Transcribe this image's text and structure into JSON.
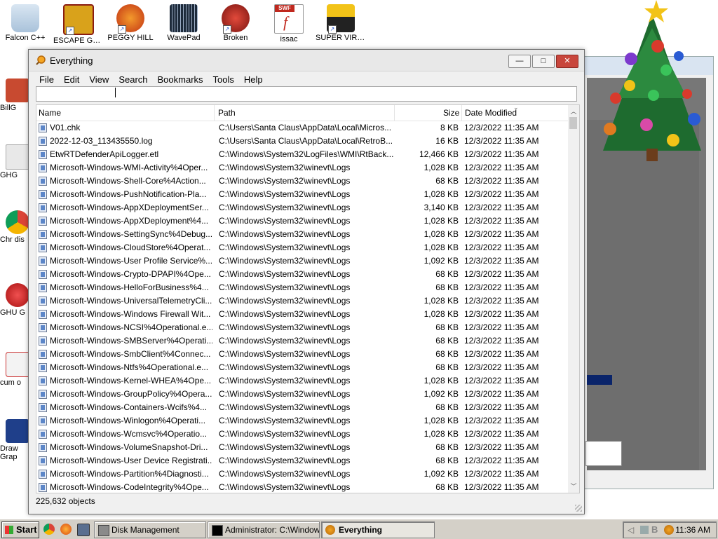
{
  "desktop": {
    "top_icons": [
      {
        "label": "Falcon C++",
        "icon": "recycle-bin-icon"
      },
      {
        "label": "ESCAPE GGP",
        "icon": "game-icon"
      },
      {
        "label": "PEGGY HILL",
        "icon": "game-icon"
      },
      {
        "label": "WavePad",
        "icon": "audio-editor-icon"
      },
      {
        "label": "Broken",
        "icon": "ornament-game-icon"
      },
      {
        "label": "issac",
        "icon": "flash-swf-icon"
      },
      {
        "label": "SUPER VIRUS",
        "icon": "truck-game-icon"
      }
    ],
    "left_icons": [
      "BillG",
      "GHG",
      "Chr dis",
      "GHU G",
      "cum o",
      "Draw Grap"
    ]
  },
  "window": {
    "title": "Everything",
    "buttons": {
      "minimize": "—",
      "maximize": "□",
      "close": "✕"
    },
    "menu": [
      "File",
      "Edit",
      "View",
      "Search",
      "Bookmarks",
      "Tools",
      "Help"
    ],
    "search_value": "",
    "columns": {
      "name": "Name",
      "path": "Path",
      "size": "Size",
      "date": "Date Modified"
    },
    "rows": [
      {
        "name": "V01.chk",
        "path": "C:\\Users\\Santa Claus\\AppData\\Local\\Micros...",
        "size": "8 KB",
        "date": "12/3/2022 11:35 AM",
        "icon": "chk-file-icon"
      },
      {
        "name": "2022-12-03_113435550.log",
        "path": "C:\\Users\\Santa Claus\\AppData\\Local\\RetroB...",
        "size": "16 KB",
        "date": "12/3/2022 11:35 AM",
        "icon": "log-file-icon"
      },
      {
        "name": "EtwRTDefenderApiLogger.etl",
        "path": "C:\\Windows\\System32\\LogFiles\\WMI\\RtBack...",
        "size": "12,466 KB",
        "date": "12/3/2022 11:35 AM",
        "icon": "etl-file-icon"
      },
      {
        "name": "Microsoft-Windows-WMI-Activity%4Oper...",
        "path": "C:\\Windows\\System32\\winevt\\Logs",
        "size": "1,028 KB",
        "date": "12/3/2022 11:35 AM",
        "icon": "evtx-file-icon"
      },
      {
        "name": "Microsoft-Windows-Shell-Core%4Action...",
        "path": "C:\\Windows\\System32\\winevt\\Logs",
        "size": "68 KB",
        "date": "12/3/2022 11:35 AM",
        "icon": "evtx-file-icon"
      },
      {
        "name": "Microsoft-Windows-PushNotification-Pla...",
        "path": "C:\\Windows\\System32\\winevt\\Logs",
        "size": "1,028 KB",
        "date": "12/3/2022 11:35 AM",
        "icon": "evtx-file-icon"
      },
      {
        "name": "Microsoft-Windows-AppXDeploymentSer...",
        "path": "C:\\Windows\\System32\\winevt\\Logs",
        "size": "3,140 KB",
        "date": "12/3/2022 11:35 AM",
        "icon": "evtx-file-icon"
      },
      {
        "name": "Microsoft-Windows-AppXDeployment%4...",
        "path": "C:\\Windows\\System32\\winevt\\Logs",
        "size": "1,028 KB",
        "date": "12/3/2022 11:35 AM",
        "icon": "evtx-file-icon"
      },
      {
        "name": "Microsoft-Windows-SettingSync%4Debug...",
        "path": "C:\\Windows\\System32\\winevt\\Logs",
        "size": "1,028 KB",
        "date": "12/3/2022 11:35 AM",
        "icon": "evtx-file-icon"
      },
      {
        "name": "Microsoft-Windows-CloudStore%4Operat...",
        "path": "C:\\Windows\\System32\\winevt\\Logs",
        "size": "1,028 KB",
        "date": "12/3/2022 11:35 AM",
        "icon": "evtx-file-icon"
      },
      {
        "name": "Microsoft-Windows-User Profile Service%...",
        "path": "C:\\Windows\\System32\\winevt\\Logs",
        "size": "1,092 KB",
        "date": "12/3/2022 11:35 AM",
        "icon": "evtx-file-icon"
      },
      {
        "name": "Microsoft-Windows-Crypto-DPAPI%4Ope...",
        "path": "C:\\Windows\\System32\\winevt\\Logs",
        "size": "68 KB",
        "date": "12/3/2022 11:35 AM",
        "icon": "evtx-file-icon"
      },
      {
        "name": "Microsoft-Windows-HelloForBusiness%4...",
        "path": "C:\\Windows\\System32\\winevt\\Logs",
        "size": "68 KB",
        "date": "12/3/2022 11:35 AM",
        "icon": "evtx-file-icon"
      },
      {
        "name": "Microsoft-Windows-UniversalTelemetryCli...",
        "path": "C:\\Windows\\System32\\winevt\\Logs",
        "size": "1,028 KB",
        "date": "12/3/2022 11:35 AM",
        "icon": "evtx-file-icon"
      },
      {
        "name": "Microsoft-Windows-Windows Firewall Wit...",
        "path": "C:\\Windows\\System32\\winevt\\Logs",
        "size": "1,028 KB",
        "date": "12/3/2022 11:35 AM",
        "icon": "evtx-file-icon"
      },
      {
        "name": "Microsoft-Windows-NCSI%4Operational.e...",
        "path": "C:\\Windows\\System32\\winevt\\Logs",
        "size": "68 KB",
        "date": "12/3/2022 11:35 AM",
        "icon": "evtx-file-icon"
      },
      {
        "name": "Microsoft-Windows-SMBServer%4Operati...",
        "path": "C:\\Windows\\System32\\winevt\\Logs",
        "size": "68 KB",
        "date": "12/3/2022 11:35 AM",
        "icon": "evtx-file-icon"
      },
      {
        "name": "Microsoft-Windows-SmbClient%4Connec...",
        "path": "C:\\Windows\\System32\\winevt\\Logs",
        "size": "68 KB",
        "date": "12/3/2022 11:35 AM",
        "icon": "evtx-file-icon"
      },
      {
        "name": "Microsoft-Windows-Ntfs%4Operational.e...",
        "path": "C:\\Windows\\System32\\winevt\\Logs",
        "size": "68 KB",
        "date": "12/3/2022 11:35 AM",
        "icon": "evtx-file-icon"
      },
      {
        "name": "Microsoft-Windows-Kernel-WHEA%4Ope...",
        "path": "C:\\Windows\\System32\\winevt\\Logs",
        "size": "1,028 KB",
        "date": "12/3/2022 11:35 AM",
        "icon": "evtx-file-icon"
      },
      {
        "name": "Microsoft-Windows-GroupPolicy%4Opera...",
        "path": "C:\\Windows\\System32\\winevt\\Logs",
        "size": "1,092 KB",
        "date": "12/3/2022 11:35 AM",
        "icon": "evtx-file-icon"
      },
      {
        "name": "Microsoft-Windows-Containers-Wcifs%4...",
        "path": "C:\\Windows\\System32\\winevt\\Logs",
        "size": "68 KB",
        "date": "12/3/2022 11:35 AM",
        "icon": "evtx-file-icon"
      },
      {
        "name": "Microsoft-Windows-Winlogon%4Operati...",
        "path": "C:\\Windows\\System32\\winevt\\Logs",
        "size": "1,028 KB",
        "date": "12/3/2022 11:35 AM",
        "icon": "evtx-file-icon"
      },
      {
        "name": "Microsoft-Windows-Wcmsvc%4Operatio...",
        "path": "C:\\Windows\\System32\\winevt\\Logs",
        "size": "1,028 KB",
        "date": "12/3/2022 11:35 AM",
        "icon": "evtx-file-icon"
      },
      {
        "name": "Microsoft-Windows-VolumeSnapshot-Dri...",
        "path": "C:\\Windows\\System32\\winevt\\Logs",
        "size": "68 KB",
        "date": "12/3/2022 11:35 AM",
        "icon": "evtx-file-icon"
      },
      {
        "name": "Microsoft-Windows-User Device Registrati...",
        "path": "C:\\Windows\\System32\\winevt\\Logs",
        "size": "68 KB",
        "date": "12/3/2022 11:35 AM",
        "icon": "evtx-file-icon"
      },
      {
        "name": "Microsoft-Windows-Partition%4Diagnosti...",
        "path": "C:\\Windows\\System32\\winevt\\Logs",
        "size": "1,092 KB",
        "date": "12/3/2022 11:35 AM",
        "icon": "evtx-file-icon"
      },
      {
        "name": "Microsoft-Windows-CodeIntegrity%4Ope...",
        "path": "C:\\Windows\\System32\\winevt\\Logs",
        "size": "68 KB",
        "date": "12/3/2022 11:35 AM",
        "icon": "evtx-file-icon"
      }
    ],
    "status": "225,632 objects"
  },
  "taskbar": {
    "start_label": "Start",
    "quick_launch": [
      "chrome-icon",
      "firefox-icon",
      "show-desktop-icon"
    ],
    "tasks": [
      {
        "label": "Disk Management",
        "icon": "disk-management-icon",
        "active": false
      },
      {
        "label": "Administrator: C:\\Windows...",
        "icon": "console-icon",
        "active": false
      },
      {
        "label": "Everything",
        "icon": "everything-search-icon",
        "active": true
      }
    ],
    "tray_icons": [
      "volume-icon",
      "network-icon",
      "b-app-icon",
      "everything-tray-icon"
    ],
    "clock": "11:36 AM"
  },
  "colors": {
    "close_button": "#c8463c",
    "taskbar": "#d4d0c8",
    "selection": "#0a246a"
  }
}
